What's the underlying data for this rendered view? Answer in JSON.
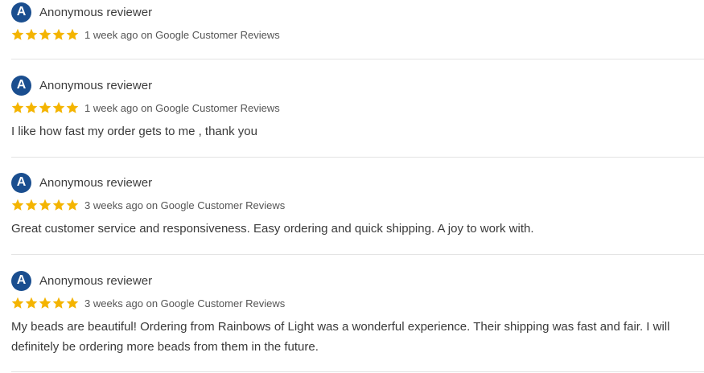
{
  "colors": {
    "avatar_bg": "#1a4e8f",
    "star": "#f4b400",
    "divider": "#e3e3e3"
  },
  "reviews": [
    {
      "avatar_letter": "A",
      "reviewer": "Anonymous reviewer",
      "rating": 5,
      "rating_max": 5,
      "when": "1 week ago on Google Customer Reviews",
      "text": ""
    },
    {
      "avatar_letter": "A",
      "reviewer": "Anonymous reviewer",
      "rating": 5,
      "rating_max": 5,
      "when": "1 week ago on Google Customer Reviews",
      "text": "I like how fast my order gets to me , thank you"
    },
    {
      "avatar_letter": "A",
      "reviewer": "Anonymous reviewer",
      "rating": 5,
      "rating_max": 5,
      "when": "3 weeks ago on Google Customer Reviews",
      "text": "Great customer service and responsiveness. Easy ordering and quick shipping. A joy to work with."
    },
    {
      "avatar_letter": "A",
      "reviewer": "Anonymous reviewer",
      "rating": 5,
      "rating_max": 5,
      "when": "3 weeks ago on Google Customer Reviews",
      "text": "My beads are beautiful! Ordering from Rainbows of Light was a wonderful experience. Their shipping was fast and fair. I will definitely be ordering more beads from them in the future."
    }
  ]
}
